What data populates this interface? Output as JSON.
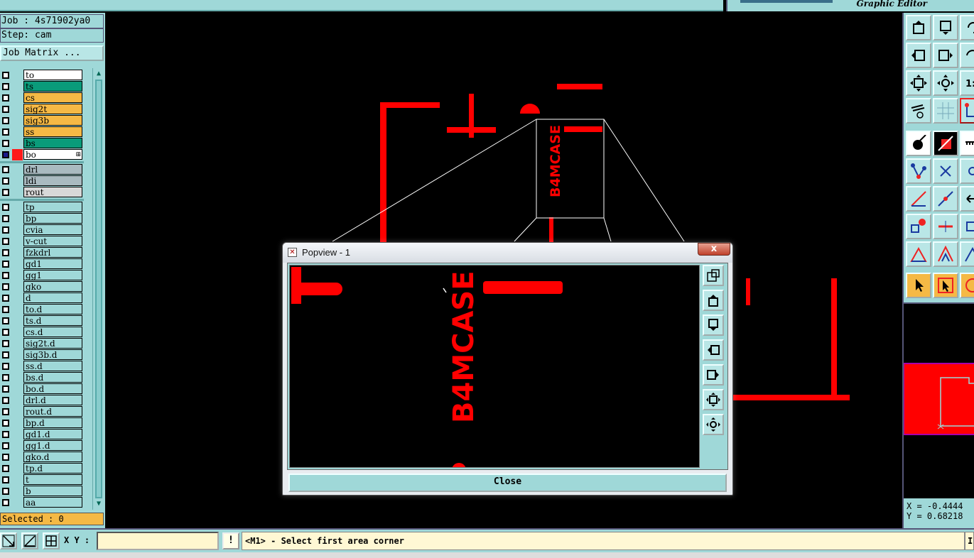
{
  "app": {
    "brand_subtitle": "Graphic Editor"
  },
  "job": {
    "job_line": "Job : 4s71902ya0",
    "step_line": "Step: cam",
    "matrix_button": "Job Matrix ..."
  },
  "layers": [
    {
      "name": "to",
      "color": "#ffffff",
      "checked": false
    },
    {
      "name": "ts",
      "color": "#0a9b7a",
      "checked": false
    },
    {
      "name": "cs",
      "color": "#f5b945",
      "checked": false
    },
    {
      "name": "sig2t",
      "color": "#f5b945",
      "checked": false
    },
    {
      "name": "sig3b",
      "color": "#f5b945",
      "checked": false
    },
    {
      "name": "ss",
      "color": "#f5b945",
      "checked": false
    },
    {
      "name": "bs",
      "color": "#0a9b7a",
      "checked": false
    },
    {
      "name": "bo",
      "color": "#ffffff",
      "checked": true,
      "active_color": "#ff1a1a",
      "mark": "⊞"
    },
    {
      "name": "drl",
      "color": "#a9bac0",
      "checked": false,
      "group_start": true
    },
    {
      "name": "ldi",
      "color": "#a9bac0",
      "checked": false
    },
    {
      "name": "rout",
      "color": "#d8d8d8",
      "checked": false
    },
    {
      "name": "tp",
      "color": "#9fd8d8",
      "checked": false,
      "group_start": true
    },
    {
      "name": "bp",
      "color": "#9fd8d8",
      "checked": false
    },
    {
      "name": "cvia",
      "color": "#9fd8d8",
      "checked": false
    },
    {
      "name": "v-cut",
      "color": "#9fd8d8",
      "checked": false
    },
    {
      "name": "fzkdrl",
      "color": "#9fd8d8",
      "checked": false
    },
    {
      "name": "gd1",
      "color": "#9fd8d8",
      "checked": false
    },
    {
      "name": "gg1",
      "color": "#9fd8d8",
      "checked": false
    },
    {
      "name": "gko",
      "color": "#9fd8d8",
      "checked": false
    },
    {
      "name": "d",
      "color": "#9fd8d8",
      "checked": false
    },
    {
      "name": "to.d",
      "color": "#9fd8d8",
      "checked": false
    },
    {
      "name": "ts.d",
      "color": "#9fd8d8",
      "checked": false
    },
    {
      "name": "cs.d",
      "color": "#9fd8d8",
      "checked": false
    },
    {
      "name": "sig2t.d",
      "color": "#9fd8d8",
      "checked": false
    },
    {
      "name": "sig3b.d",
      "color": "#9fd8d8",
      "checked": false
    },
    {
      "name": "ss.d",
      "color": "#9fd8d8",
      "checked": false
    },
    {
      "name": "bs.d",
      "color": "#9fd8d8",
      "checked": false
    },
    {
      "name": "bo.d",
      "color": "#9fd8d8",
      "checked": false
    },
    {
      "name": "drl.d",
      "color": "#9fd8d8",
      "checked": false
    },
    {
      "name": "rout.d",
      "color": "#9fd8d8",
      "checked": false
    },
    {
      "name": "bp.d",
      "color": "#9fd8d8",
      "checked": false
    },
    {
      "name": "gd1.d",
      "color": "#9fd8d8",
      "checked": false
    },
    {
      "name": "gg1.d",
      "color": "#9fd8d8",
      "checked": false
    },
    {
      "name": "gko.d",
      "color": "#9fd8d8",
      "checked": false
    },
    {
      "name": "tp.d",
      "color": "#9fd8d8",
      "checked": false
    },
    {
      "name": "t",
      "color": "#9fd8d8",
      "checked": false
    },
    {
      "name": "b",
      "color": "#9fd8d8",
      "checked": false
    },
    {
      "name": "aa",
      "color": "#9fd8d8",
      "checked": false
    }
  ],
  "selected_line": "Selected : 0",
  "bottom": {
    "xy_label": "X Y :",
    "xy_value": "",
    "warn_label": "!",
    "status_message": "<M1> - Select first area corner",
    "status_end": "I"
  },
  "coords": {
    "x_line": "X = -0.4444",
    "y_line": "Y = 0.68218"
  },
  "popview": {
    "title": "Popview - 1",
    "close_x": "x",
    "close_label": "Close"
  },
  "board": {
    "text": "B4MCASE",
    "feature_color": "#ff0000",
    "outline_color": "#ffffff"
  }
}
